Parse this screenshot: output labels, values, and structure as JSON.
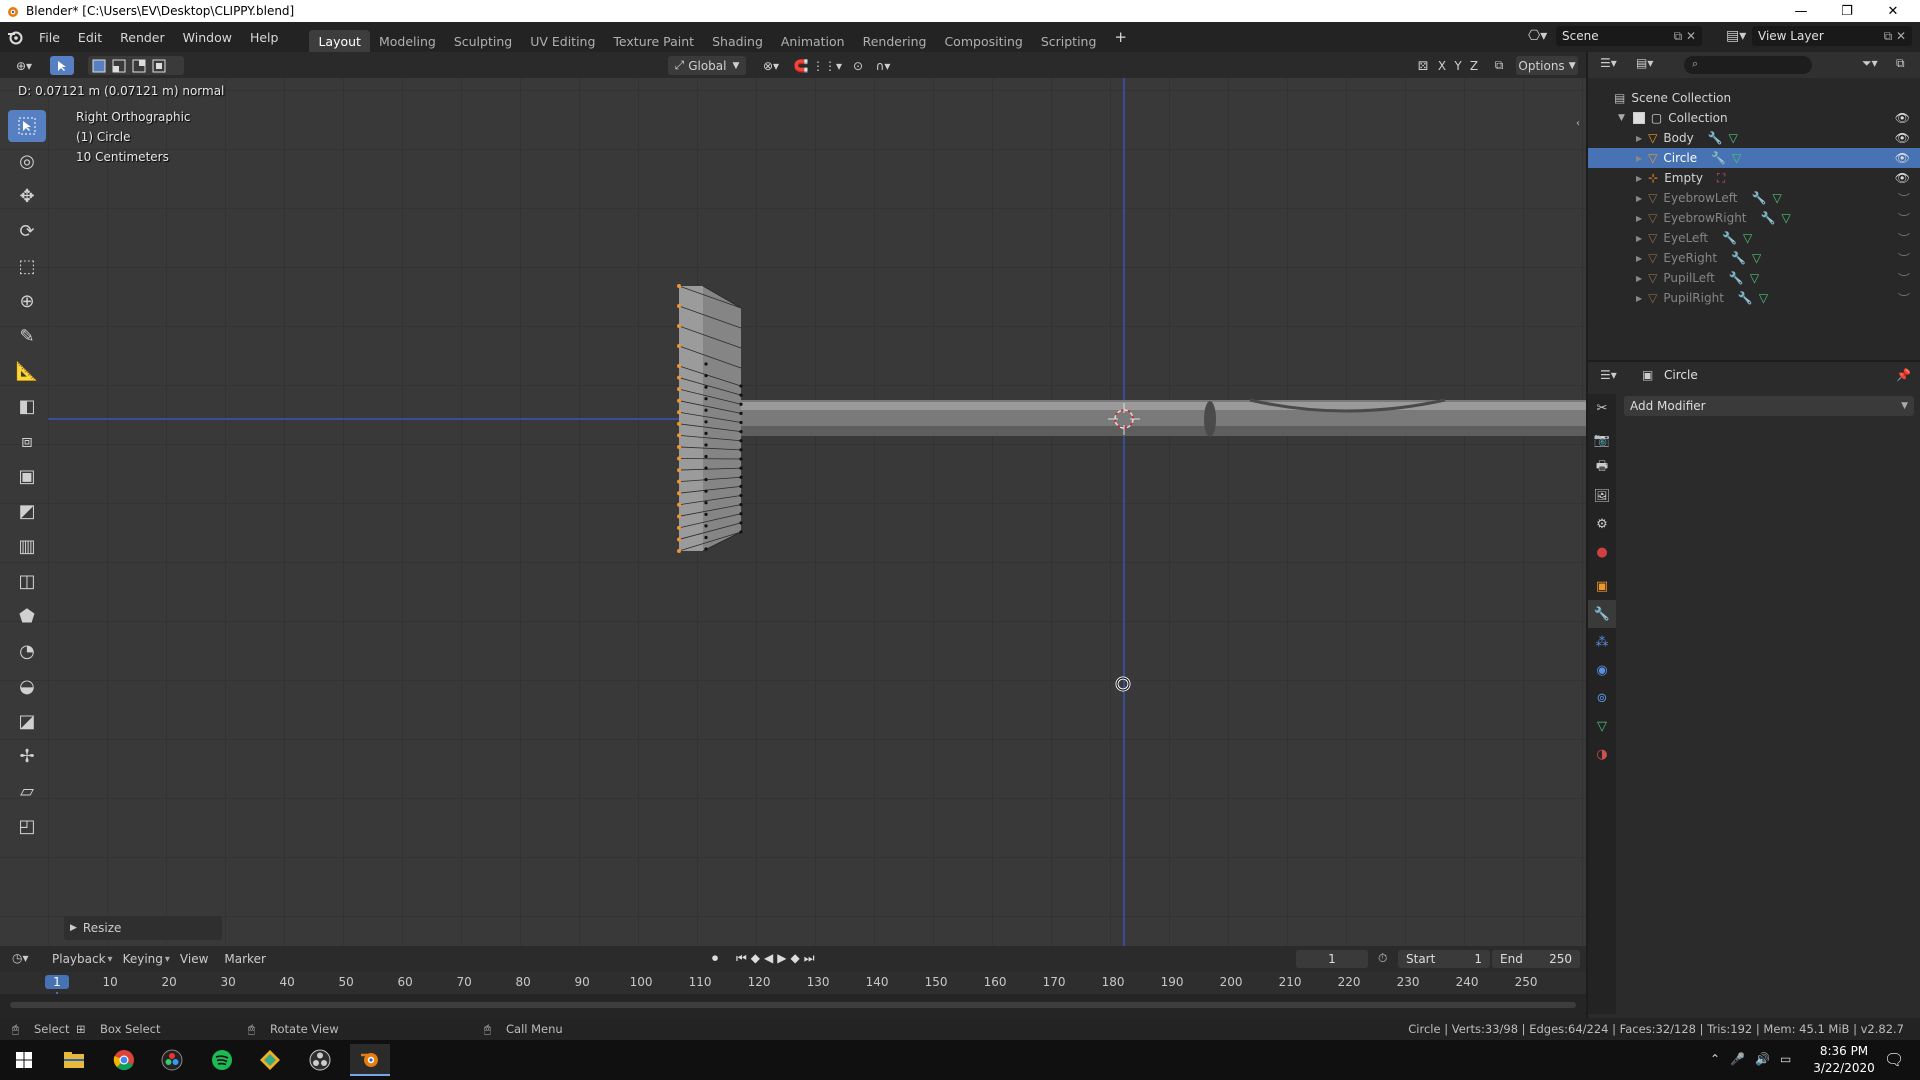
{
  "window": {
    "title": "Blender* [C:\\Users\\EV\\Desktop\\CLIPPY.blend]",
    "minimize": "—",
    "restore": "❐",
    "close": "✕"
  },
  "menus": [
    "File",
    "Edit",
    "Render",
    "Window",
    "Help"
  ],
  "workspaces": [
    {
      "label": "Layout",
      "active": true
    },
    {
      "label": "Modeling"
    },
    {
      "label": "Sculpting"
    },
    {
      "label": "UV Editing"
    },
    {
      "label": "Texture Paint"
    },
    {
      "label": "Shading"
    },
    {
      "label": "Animation"
    },
    {
      "label": "Rendering"
    },
    {
      "label": "Compositing"
    },
    {
      "label": "Scripting"
    }
  ],
  "add_workspace": "+",
  "scene_field": "Scene",
  "view_layer_field": "View Layer",
  "viewport_header": {
    "orientation": "Global",
    "axes": [
      "X",
      "Y",
      "Z"
    ],
    "options": "Options"
  },
  "viewport": {
    "operator_status": "D: 0.07121 m (0.07121 m) normal",
    "view_name": "Right Orthographic",
    "object_name": "(1) Circle",
    "scale": "10 Centimeters",
    "resize_panel": "Resize"
  },
  "outliner": {
    "root": "Scene Collection",
    "collection": "Collection",
    "objects": [
      {
        "name": "Body",
        "visible": true
      },
      {
        "name": "Circle",
        "visible": true,
        "selected": true
      },
      {
        "name": "Empty",
        "visible": true
      },
      {
        "name": "EyebrowLeft",
        "visible": false
      },
      {
        "name": "EyebrowRight",
        "visible": false
      },
      {
        "name": "EyeLeft",
        "visible": false
      },
      {
        "name": "EyeRight",
        "visible": false
      },
      {
        "name": "PupilLeft",
        "visible": false
      },
      {
        "name": "PupilRight",
        "visible": false
      }
    ]
  },
  "properties": {
    "object": "Circle",
    "add_modifier": "Add Modifier"
  },
  "timeline": {
    "menus": [
      "Playback",
      "Keying",
      "View",
      "Marker"
    ],
    "current_frame": "1",
    "start_label": "Start",
    "start_value": "1",
    "end_label": "End",
    "end_value": "250",
    "ruler": [
      "1",
      "10",
      "20",
      "30",
      "40",
      "50",
      "60",
      "70",
      "80",
      "90",
      "100",
      "110",
      "120",
      "130",
      "140",
      "150",
      "160",
      "170",
      "180",
      "190",
      "200",
      "210",
      "220",
      "230",
      "240",
      "250"
    ]
  },
  "statusbar": {
    "select": "Select",
    "box_select": "Box Select",
    "rotate_view": "Rotate View",
    "call_menu": "Call Menu",
    "stats": "Circle | Verts:33/98 | Edges:64/224 | Faces:32/128 | Tris:192 | Mem: 45.1 MiB | v2.82.7"
  },
  "taskbar": {
    "time": "8:36 PM",
    "date": "3/22/2020"
  },
  "colors": {
    "accent": "#4772b3",
    "active_tool": "#5680c2",
    "selected_vertex": "#f0962a",
    "axis_line": "#3b5bd0"
  }
}
